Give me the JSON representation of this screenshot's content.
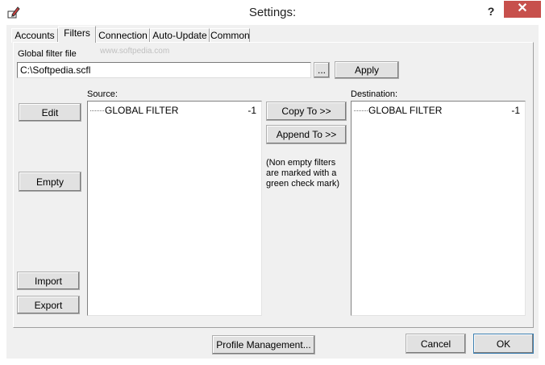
{
  "window": {
    "title": "Settings:",
    "help": "?",
    "close": "✕"
  },
  "tabs": [
    {
      "label": "Accounts"
    },
    {
      "label": "Filters"
    },
    {
      "label": "Connection"
    },
    {
      "label": "Auto-Update"
    },
    {
      "label": "Common"
    }
  ],
  "filters": {
    "global_filter_label": "Global filter file",
    "global_filter_value": "C:\\Softpedia.scfl",
    "browse_label": "...",
    "apply_label": "Apply",
    "source_label": "Source:",
    "destination_label": "Destination:",
    "edit_label": "Edit",
    "empty_label": "Empty",
    "import_label": "Import",
    "export_label": "Export",
    "copy_to_label": "Copy To >>",
    "append_to_label": "Append To >>",
    "note": "(Non empty filters are marked with a green check mark)",
    "source_items": [
      {
        "name": "GLOBAL FILTER",
        "value": "-1"
      }
    ],
    "destination_items": [
      {
        "name": "GLOBAL FILTER",
        "value": "-1"
      }
    ]
  },
  "footer": {
    "profile_label": "Profile Management...",
    "cancel_label": "Cancel",
    "ok_label": "OK"
  },
  "watermark": "www.softpedia.com",
  "colors": {
    "close_button": "#c7504c",
    "default_button_border": "#3c7fb1"
  }
}
